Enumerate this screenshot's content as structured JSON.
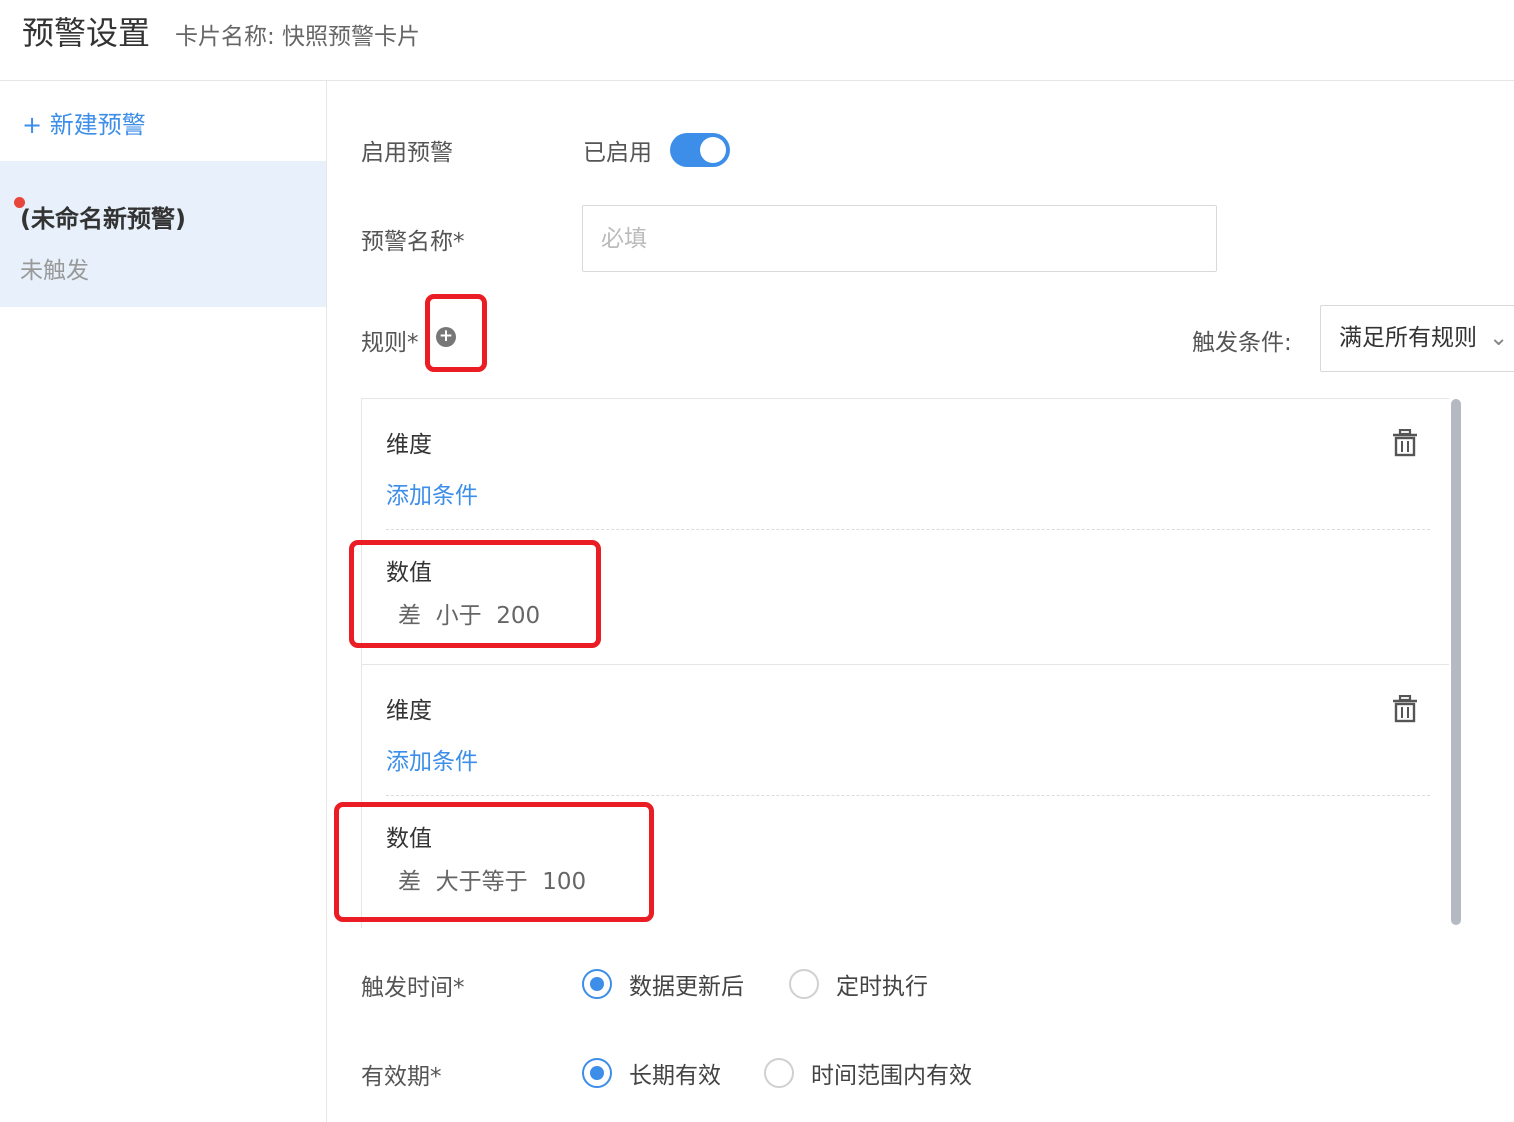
{
  "header": {
    "title": "预警设置",
    "subtitle": "卡片名称: 快照预警卡片"
  },
  "sidebar": {
    "new_alert_label": "+ 新建预警",
    "items": [
      {
        "name": "(未命名新预警)",
        "state": "未触发",
        "status_color": "#e8453c"
      }
    ]
  },
  "form": {
    "enable": {
      "label": "启用预警",
      "status_text": "已启用",
      "enabled": true
    },
    "name": {
      "label": "预警名称*",
      "value": "",
      "placeholder": "必填"
    },
    "rules": {
      "label": "规则*",
      "add_icon": "plus-circle-icon",
      "trigger_condition_label": "触发条件:",
      "trigger_condition_value": "满足所有规则",
      "items": [
        {
          "dimension_label": "维度",
          "add_condition_label": "添加条件",
          "value_label": "数值",
          "condition": "差  小于  200"
        },
        {
          "dimension_label": "维度",
          "add_condition_label": "添加条件",
          "value_label": "数值",
          "condition": "差  大于等于  100"
        }
      ]
    },
    "trigger_time": {
      "label": "触发时间*",
      "options": [
        {
          "label": "数据更新后",
          "checked": true
        },
        {
          "label": "定时执行",
          "checked": false
        }
      ]
    },
    "validity": {
      "label": "有效期*",
      "options": [
        {
          "label": "长期有效",
          "checked": true
        },
        {
          "label": "时间范围内有效",
          "checked": false
        }
      ]
    }
  },
  "colors": {
    "accent": "#3c8ee8",
    "highlight": "#ea1c24",
    "selected_bg": "#e7f0fb"
  }
}
